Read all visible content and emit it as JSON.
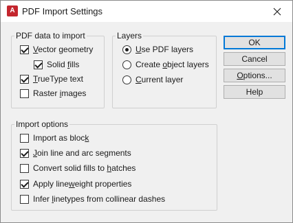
{
  "window": {
    "title": "PDF Import Settings",
    "app_icon_letter": "A"
  },
  "pdf_data_group": {
    "label": "PDF data to import",
    "vector_geometry": {
      "pre": "",
      "u": "V",
      "post": "ector geometry",
      "checked": true
    },
    "solid_fills": {
      "pre": "Solid ",
      "u": "f",
      "post": "ills",
      "checked": true
    },
    "truetype_text": {
      "pre": "",
      "u": "T",
      "post": "rueType text",
      "checked": true
    },
    "raster_images": {
      "pre": "Raster ",
      "u": "i",
      "post": "mages",
      "checked": false
    }
  },
  "layers_group": {
    "label": "Layers",
    "use_pdf_layers": {
      "pre": "",
      "u": "U",
      "post": "se PDF layers",
      "selected": true
    },
    "create_object_layers": {
      "pre": "Create ",
      "u": "o",
      "post": "bject layers",
      "selected": false
    },
    "current_layer": {
      "pre": "",
      "u": "C",
      "post": "urrent layer",
      "selected": false
    }
  },
  "buttons": {
    "ok": "OK",
    "cancel": "Cancel",
    "options_pre": "",
    "options_u": "O",
    "options_post": "ptions...",
    "help": "Help"
  },
  "import_options_group": {
    "label": "Import options",
    "import_as_block": {
      "pre": "Import as bloc",
      "u": "k",
      "post": "",
      "checked": false
    },
    "join_segments": {
      "pre": "",
      "u": "J",
      "post": "oin line and arc segments",
      "checked": true
    },
    "convert_fills": {
      "pre": "Convert solid fills to ",
      "u": "h",
      "post": "atches",
      "checked": false
    },
    "apply_lineweight": {
      "pre": "Apply line",
      "u": "w",
      "post": "eight properties",
      "checked": true
    },
    "infer_linetypes": {
      "pre": "Infer ",
      "u": "l",
      "post": "inetypes from collinear dashes",
      "checked": false
    }
  }
}
